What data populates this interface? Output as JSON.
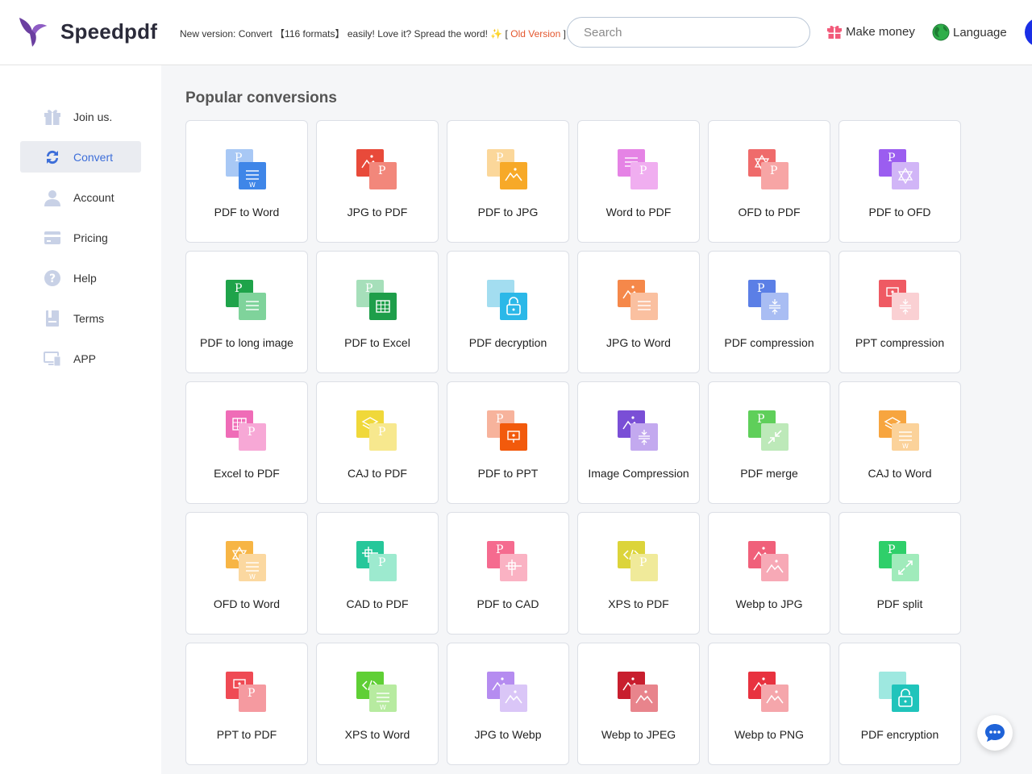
{
  "brand": {
    "name": "Speedpdf"
  },
  "header": {
    "notice_text": "New version: Convert 【116 formats】 easily! Love it? Spread the word! ✨ [",
    "old_version_label": "Old Version",
    "notice_close": "]",
    "search_placeholder": "Search",
    "make_money_label": "Make money",
    "language_label": "Language"
  },
  "sidebar": {
    "items": [
      {
        "label": "Join us.",
        "icon": "gift-icon",
        "active": false
      },
      {
        "label": "Convert",
        "icon": "convert-icon",
        "active": true
      },
      {
        "label": "Account",
        "icon": "user-icon",
        "active": false
      },
      {
        "label": "Pricing",
        "icon": "card-icon",
        "active": false
      },
      {
        "label": "Help",
        "icon": "help-icon",
        "active": false
      },
      {
        "label": "Terms",
        "icon": "terms-icon",
        "active": false
      },
      {
        "label": "APP",
        "icon": "devices-icon",
        "active": false
      }
    ]
  },
  "main": {
    "title": "Popular conversions",
    "cards": [
      {
        "label": "PDF to Word",
        "back": "#a8c8f5",
        "front": "#3f86e8",
        "bl": "P",
        "fg": "lines",
        "fl": "W"
      },
      {
        "label": "JPG to PDF",
        "back": "#e84a3a",
        "front": "#f2877b",
        "bl": "img",
        "fg": "letter",
        "fl": "P"
      },
      {
        "label": "PDF to JPG",
        "back": "#fbd79a",
        "front": "#f7a928",
        "bl": "P",
        "fg": "img",
        "fl": ""
      },
      {
        "label": "Word to PDF",
        "back": "#e583e5",
        "front": "#f0aef0",
        "bl": "lines",
        "fg": "letter",
        "fl": "P"
      },
      {
        "label": "OFD to PDF",
        "back": "#ef6b6b",
        "front": "#f7a5a5",
        "bl": "star",
        "fg": "letter",
        "fl": "P"
      },
      {
        "label": "PDF to OFD",
        "back": "#9b5df0",
        "front": "#d1b5f7",
        "bl": "P",
        "fg": "star",
        "fl": ""
      },
      {
        "label": "PDF to long image",
        "back": "#1fa34a",
        "front": "#7fd39b",
        "bl": "P",
        "fg": "lines",
        "fl": ""
      },
      {
        "label": "PDF to Excel",
        "back": "#a6dfba",
        "front": "#1e9e4a",
        "bl": "P",
        "fg": "grid",
        "fl": ""
      },
      {
        "label": "PDF decryption",
        "back": "#a3ddf0",
        "front": "#2bb8e8",
        "bl": "",
        "fg": "lock",
        "fl": ""
      },
      {
        "label": "JPG to Word",
        "back": "#f5884a",
        "front": "#fac0a0",
        "bl": "img",
        "fg": "lines",
        "fl": ""
      },
      {
        "label": "PDF compression",
        "back": "#5b7fe6",
        "front": "#a9bdf3",
        "bl": "P",
        "fg": "compress",
        "fl": ""
      },
      {
        "label": "PPT compression",
        "back": "#ef5a63",
        "front": "#fad0d3",
        "bl": "ppt",
        "fg": "compress",
        "fl": ""
      },
      {
        "label": "Excel to PDF",
        "back": "#ef6cb7",
        "front": "#f7a8d6",
        "bl": "grid",
        "fg": "letter",
        "fl": "P"
      },
      {
        "label": "CAJ to PDF",
        "back": "#f0d83a",
        "front": "#f7e88e",
        "bl": "layers",
        "fg": "letter",
        "fl": "P"
      },
      {
        "label": "PDF to PPT",
        "back": "#f7b39c",
        "front": "#f25a0c",
        "bl": "P",
        "fg": "ppt",
        "fl": ""
      },
      {
        "label": "Image Compression",
        "back": "#7a4fd6",
        "front": "#c3a9ef",
        "bl": "img",
        "fg": "compress",
        "fl": ""
      },
      {
        "label": "PDF merge",
        "back": "#5fcf5a",
        "front": "#bde9b9",
        "bl": "P",
        "fg": "merge",
        "fl": ""
      },
      {
        "label": "CAJ to Word",
        "back": "#f7a53f",
        "front": "#fbd29a",
        "bl": "layers",
        "fg": "lines",
        "fl": "W"
      },
      {
        "label": "OFD to Word",
        "back": "#f7b545",
        "front": "#fbd8a0",
        "bl": "star",
        "fg": "lines",
        "fl": "W"
      },
      {
        "label": "CAD to PDF",
        "back": "#26c79a",
        "front": "#9deacf",
        "bl": "cad",
        "fg": "letter",
        "fl": "P"
      },
      {
        "label": "PDF to CAD",
        "back": "#f56b8f",
        "front": "#fab2c3",
        "bl": "P",
        "fg": "cad",
        "fl": ""
      },
      {
        "label": "XPS to PDF",
        "back": "#dcd43a",
        "front": "#f0ea9a",
        "bl": "code",
        "fg": "letter",
        "fl": "P"
      },
      {
        "label": "Webp to JPG",
        "back": "#f0607a",
        "front": "#f7a9b6",
        "bl": "img",
        "fg": "img",
        "fl": ""
      },
      {
        "label": "PDF split",
        "back": "#2fcf6a",
        "front": "#a0ebbb",
        "bl": "P",
        "fg": "split",
        "fl": ""
      },
      {
        "label": "PPT to PDF",
        "back": "#ef4a54",
        "front": "#f59aa0",
        "bl": "ppt",
        "fg": "letter",
        "fl": "P"
      },
      {
        "label": "XPS to Word",
        "back": "#5fcf35",
        "front": "#b7eba0",
        "bl": "code",
        "fg": "lines",
        "fl": "W"
      },
      {
        "label": "JPG to Webp",
        "back": "#b58cf0",
        "front": "#dac6f7",
        "bl": "img",
        "fg": "img",
        "fl": ""
      },
      {
        "label": "Webp to JPEG",
        "back": "#c81e2e",
        "front": "#e8848c",
        "bl": "img",
        "fg": "img",
        "fl": ""
      },
      {
        "label": "Webp to PNG",
        "back": "#e8323f",
        "front": "#f5a6ab",
        "bl": "img",
        "fg": "img",
        "fl": ""
      },
      {
        "label": "PDF encryption",
        "back": "#9ee8e0",
        "front": "#20c4bb",
        "bl": "",
        "fg": "lock",
        "fl": ""
      }
    ]
  }
}
